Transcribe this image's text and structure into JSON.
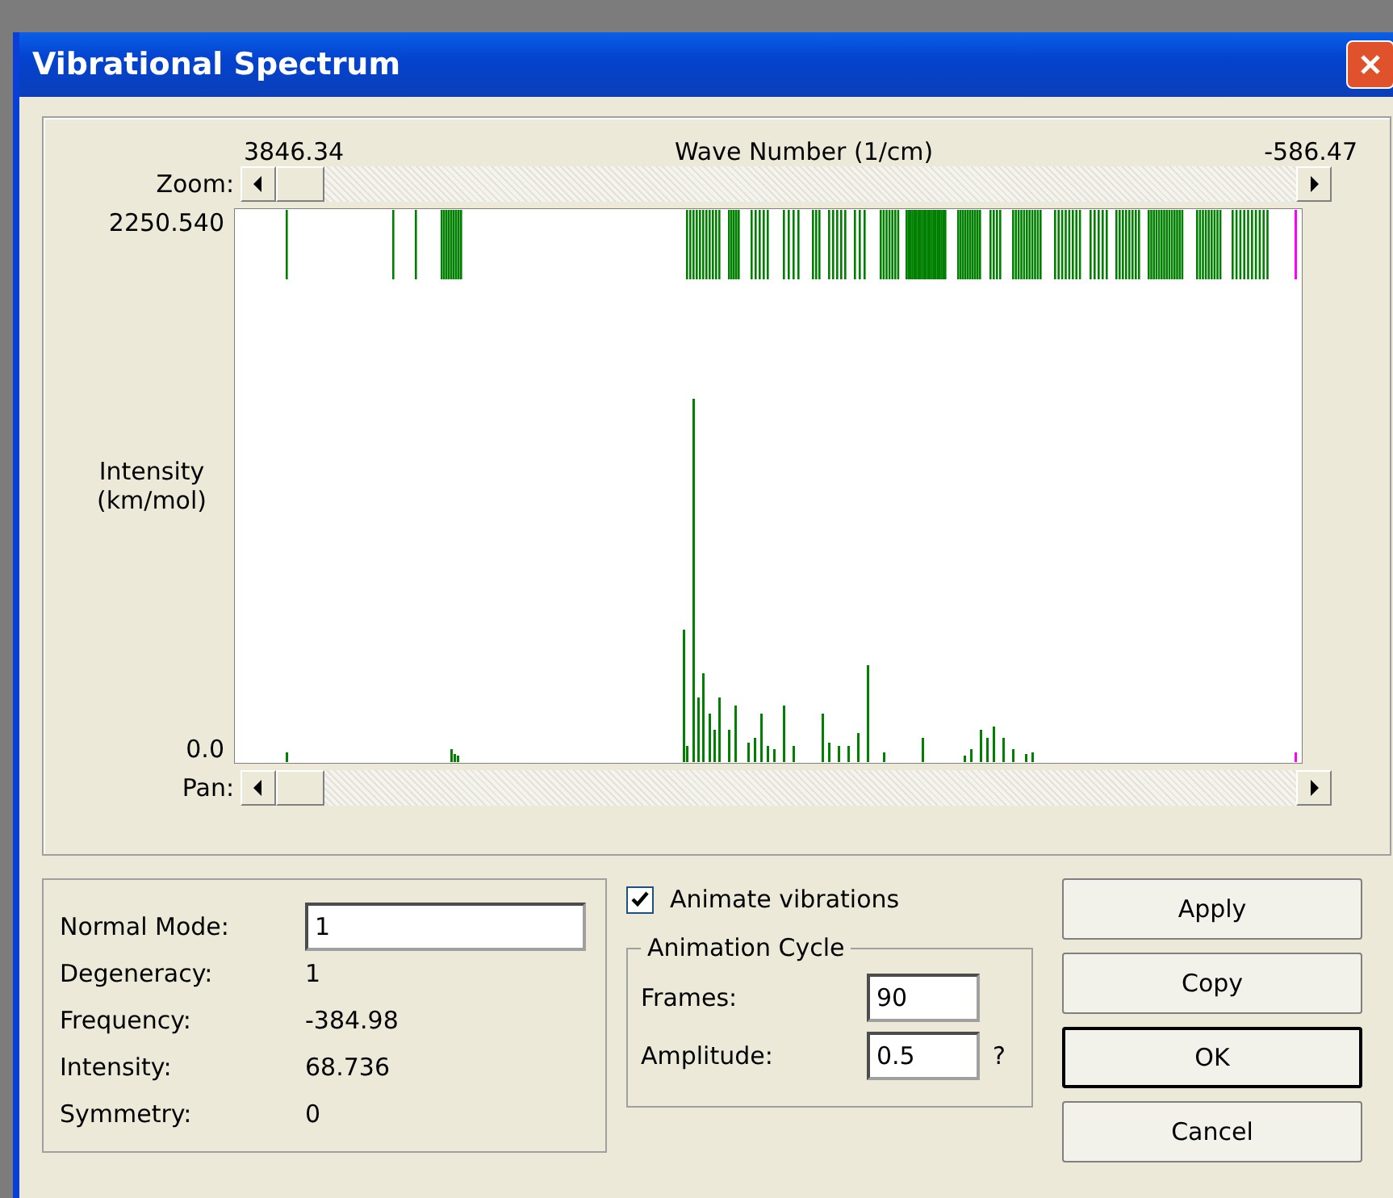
{
  "window": {
    "title": "Vibrational Spectrum"
  },
  "spectrum": {
    "x_start": "3846.34",
    "x_title": "Wave Number (1/cm)",
    "x_end": "-586.47",
    "zoom_label": "Zoom:",
    "y_max": "2250.540",
    "y_title": "Intensity (km/mol)",
    "y_min": "0.0",
    "pan_label": "Pan:"
  },
  "mode_info": [
    {
      "label": "Normal Mode:",
      "value": "1",
      "kind": "input"
    },
    {
      "label": "Degeneracy:",
      "value": "1",
      "kind": "text"
    },
    {
      "label": "Frequency:",
      "value": "-384.98",
      "kind": "text"
    },
    {
      "label": "Intensity:",
      "value": "68.736",
      "kind": "text"
    },
    {
      "label": "Symmetry:",
      "value": "0",
      "kind": "text"
    }
  ],
  "animate": {
    "label": "Animate vibrations",
    "checked": true
  },
  "animation_cycle": {
    "title": "Animation Cycle",
    "fields": [
      {
        "label": "Frames:",
        "value": "90"
      },
      {
        "label": "Amplitude:",
        "value": "0.5",
        "hint": "?"
      }
    ]
  },
  "buttons": [
    {
      "label": "Apply",
      "default": false
    },
    {
      "label": "Copy",
      "default": false
    },
    {
      "label": "OK",
      "default": true
    },
    {
      "label": "Cancel",
      "default": false
    }
  ]
}
